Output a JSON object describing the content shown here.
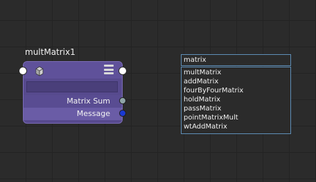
{
  "node": {
    "title": "multMatrix1",
    "icon": "cube-stack-icon",
    "menu_icon": "list-menu-icon",
    "attributes": [
      {
        "label": "Matrix Sum",
        "port_color": "#8fa5a7"
      },
      {
        "label": "Message",
        "port_color": "#1a39d1"
      }
    ],
    "colors": {
      "body": "#574a8e",
      "border": "#7b6cb8"
    }
  },
  "search": {
    "value": "matrix",
    "results": [
      "multMatrix",
      "addMatrix",
      "fourByFourMatrix",
      "holdMatrix",
      "passMatrix",
      "pointMatrixMult",
      "wtAddMatrix"
    ]
  }
}
